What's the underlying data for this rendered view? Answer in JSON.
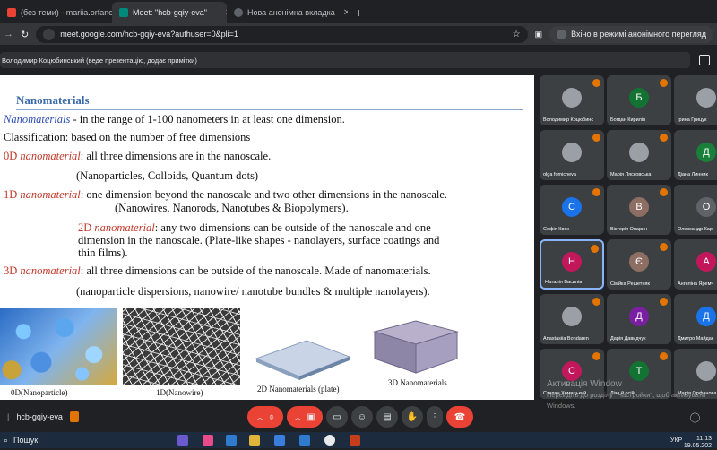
{
  "browser": {
    "tabs": [
      {
        "label": "(без теми) - mariia.orfanova@",
        "active": false
      },
      {
        "label": "Meet: \"hcb-gqiy-eva\"",
        "active": true
      },
      {
        "label": "Нова анонімна вкладка",
        "active": false
      }
    ],
    "new_tab": "+",
    "url": "meet.google.com/hcb-gqiy-eva?authuser=0&pli=1",
    "incognito_label": "Вхіно в режимі анонімного перегляд"
  },
  "meet": {
    "presenter_banner": "Володимир Коцюбинський (веде презентацію, додає примітки)",
    "meeting_code": "hcb-gqiy-eva",
    "clock_time": "11:13",
    "clock_date": "19.05.202",
    "activate": {
      "title": "Активація Window",
      "subtitle": "Перейдіть до розділу \"Настройки\", щоб активувати Windows."
    },
    "participants": [
      {
        "name": "Володимир Коцюбинс",
        "initial": "",
        "color": "#5f6368",
        "photo": true
      },
      {
        "name": "Богдан Кирилів",
        "initial": "Б",
        "color": "#137333"
      },
      {
        "name": "Ірина Грицук",
        "initial": "",
        "color": "#5f6368",
        "photo": true
      },
      {
        "name": "olga fomicheva",
        "initial": "",
        "color": "#5f6368",
        "photo": true
      },
      {
        "name": "Марія Лясковська",
        "initial": "",
        "color": "#5f6368",
        "photo": true
      },
      {
        "name": "Діана Линник",
        "initial": "Д",
        "color": "#188038"
      },
      {
        "name": "Софія Квок",
        "initial": "С",
        "color": "#1a73e8"
      },
      {
        "name": "Вікторія Опарин",
        "initial": "В",
        "color": "#8d6e63"
      },
      {
        "name": "Олександр Кар",
        "initial": "О",
        "color": "#5f6368"
      },
      {
        "name": "Наталія Василів",
        "initial": "Н",
        "color": "#c2185b"
      },
      {
        "name": "Сімйка Решетняк",
        "initial": "Є",
        "color": "#8d6e63"
      },
      {
        "name": "Ангеліна Яремч",
        "initial": "А",
        "color": "#c2185b"
      },
      {
        "name": "Anastasiia Bondaren",
        "initial": "",
        "color": "#5f6368",
        "photo": true
      },
      {
        "name": "Дарія Давидчук",
        "initial": "Д",
        "color": "#7b1fa2"
      },
      {
        "name": "Дмитро Майдак",
        "initial": "Д",
        "color": "#1a73e8"
      },
      {
        "name": "Степан Хомицький",
        "initial": "С",
        "color": "#c2185b"
      },
      {
        "name": "Ліза й осій",
        "initial": "Т",
        "color": "#137333"
      },
      {
        "name": "Марія Орфанова",
        "initial": "",
        "color": "#5f6368",
        "photo": true
      }
    ]
  },
  "slide": {
    "title": "Nanomaterials",
    "l1_term": "Nanomaterials",
    "l1_rest": " - in the range of 1-100 nanometers in at least one dimension.",
    "l2": "Classification: based on the number of free dimensions",
    "l3_a": "0D ",
    "l3_b": "nanomaterial",
    "l3_c": ": all three dimensions are in the nanoscale.",
    "l4": "(Nanoparticles, Colloids, Quantum dots)",
    "l5_a": "1D ",
    "l5_b": "nanomaterial",
    "l5_c": ": one dimension beyond the nanoscale and two other dimensions in the nanoscale.",
    "l6": "(Nanowires, Nanorods, Nanotubes & Biopolymers).",
    "l7_a": "2D ",
    "l7_b": "nanomaterial",
    "l7_c": ": any two dimensions can be outside of the nanoscale and one",
    "l8": "dimension in the nanoscale.        (Plate-like shapes - nanolayers, surface coatings and",
    "l9": "thin films).",
    "l10_a": "3D ",
    "l10_b": "nanomaterial",
    "l10_c": ": all three dimensions can be outside of the nanoscale. Made of nanomaterials.",
    "l11": "(nanoparticle dispersions, nanowire/ nanotube bundles & multiple nanolayers).",
    "cap_0d": "0D(Nanoparticle)",
    "cap_1d": "1D(Nanowire)",
    "cap_2d": "2D Nanomaterials (plate)",
    "cap_3d": "3D Nanomaterials"
  },
  "taskbar": {
    "search_label": "Пошук",
    "lang": "УКР"
  }
}
